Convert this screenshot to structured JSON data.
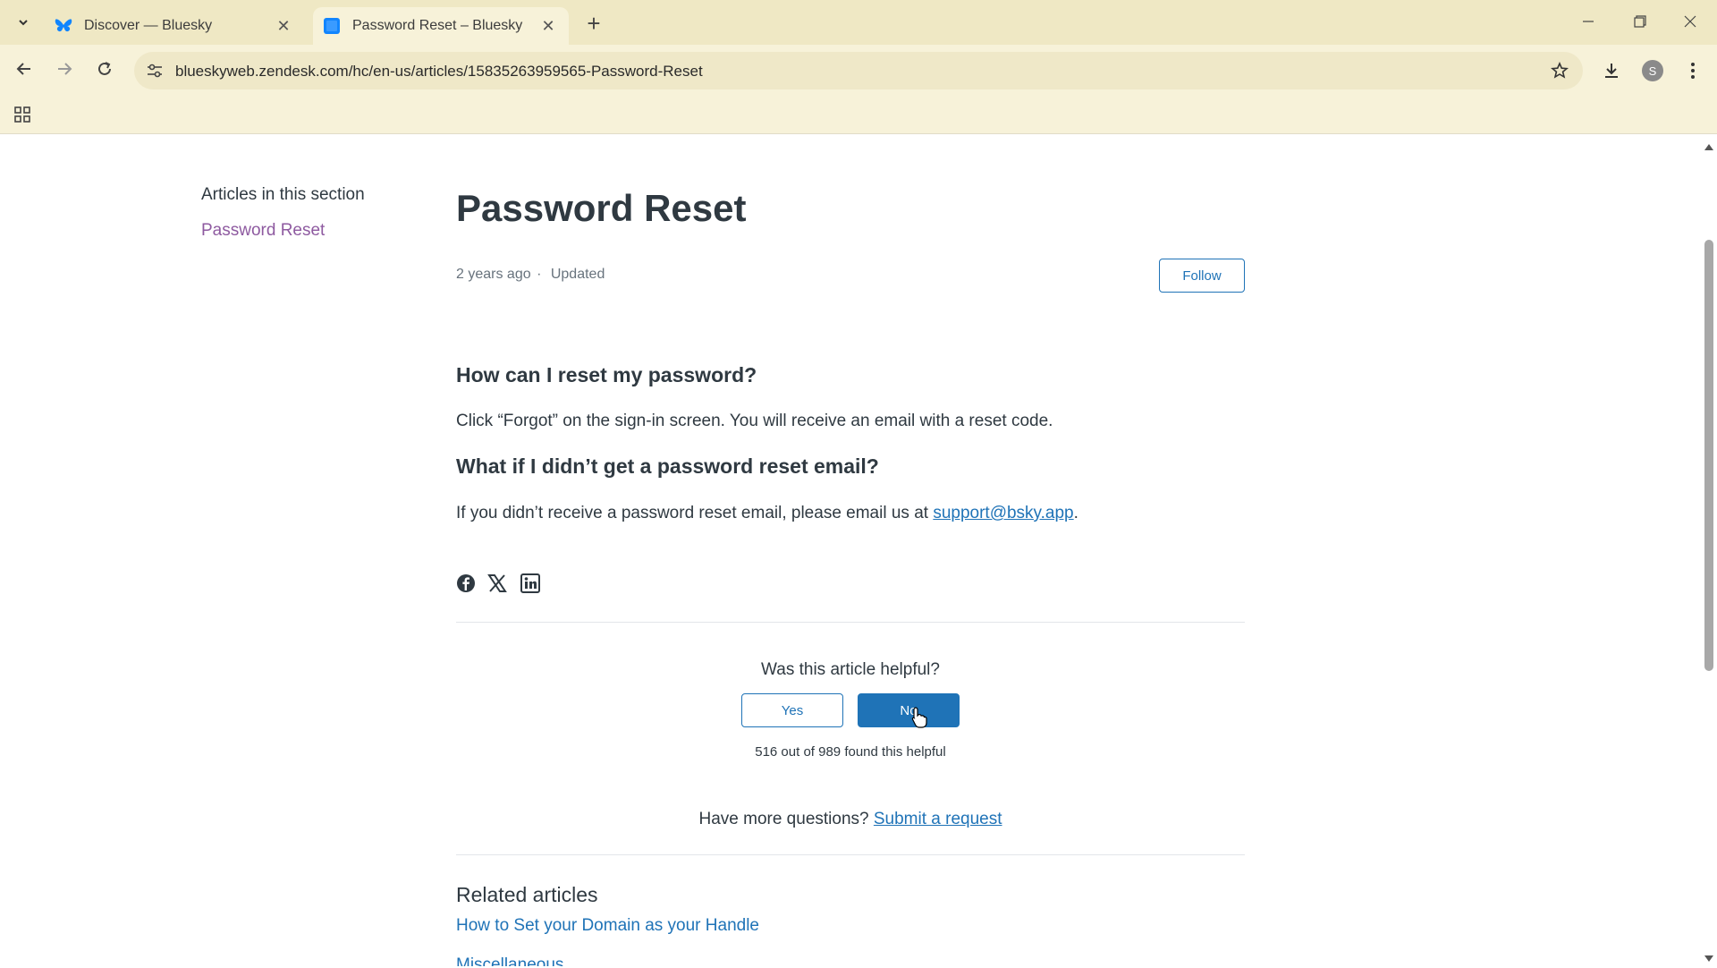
{
  "browser": {
    "tabs": [
      {
        "title": "Discover — Bluesky",
        "favicon": "bluesky-butterfly-icon",
        "active": false
      },
      {
        "title": "Password Reset – Bluesky",
        "favicon": "zendesk-page-icon",
        "active": true
      }
    ],
    "url": "blueskyweb.zendesk.com/hc/en-us/articles/15835263959565-Password-Reset",
    "profile_initial": "S"
  },
  "sidebar": {
    "title": "Articles in this section",
    "items": [
      {
        "label": "Password Reset"
      }
    ]
  },
  "article": {
    "title": "Password Reset",
    "meta_time": "2 years ago",
    "meta_sep": "·",
    "meta_updated": "Updated",
    "follow_label": "Follow",
    "sections": [
      {
        "heading": "How can I reset my password?",
        "body": "Click “Forgot” on the sign-in screen. You will receive an email with a reset code."
      },
      {
        "heading": "What if I didn’t get a password reset email?",
        "body_prefix": "If you didn’t receive a password reset email, please email us at ",
        "body_link": "support@bsky.app",
        "body_suffix": "."
      }
    ],
    "share_icons": [
      "facebook-icon",
      "x-twitter-icon",
      "linkedin-icon"
    ]
  },
  "feedback": {
    "question": "Was this article helpful?",
    "yes_label": "Yes",
    "no_label": "No",
    "count_text": "516 out of 989 found this helpful"
  },
  "more_questions": {
    "text": "Have more questions? ",
    "link": "Submit a request"
  },
  "related": {
    "title": "Related articles",
    "items": [
      {
        "label": "How to Set your Domain as your Handle"
      },
      {
        "label": "Miscellaneous"
      }
    ]
  },
  "colors": {
    "accent": "#1f73b7",
    "visited": "#8e5aa0",
    "chrome_bg": "#f7f2d9"
  }
}
